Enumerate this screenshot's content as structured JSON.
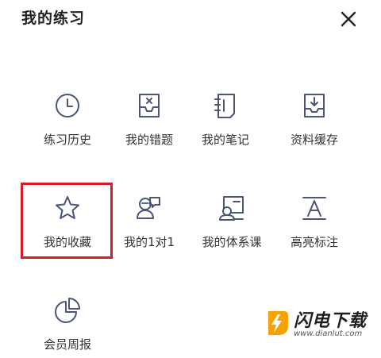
{
  "header": {
    "title": "我的练习",
    "close_icon": "close-icon"
  },
  "grid": {
    "items": [
      {
        "label": "练习历史",
        "icon": "clock-icon"
      },
      {
        "label": "我的错题",
        "icon": "inbox-x-icon"
      },
      {
        "label": "我的笔记",
        "icon": "notebook-icon"
      },
      {
        "label": "资料缓存",
        "icon": "download-tray-icon"
      },
      {
        "label": "我的收藏",
        "icon": "star-icon"
      },
      {
        "label": "我的1对1",
        "icon": "tutor-chat-icon"
      },
      {
        "label": "我的体系课",
        "icon": "course-screen-icon"
      },
      {
        "label": "高亮标注",
        "icon": "highlight-text-icon"
      },
      {
        "label": "会员周报",
        "icon": "pie-chart-icon"
      }
    ]
  },
  "watermark": {
    "title": "闪电下载",
    "url": "www.dianlut.com"
  },
  "colors": {
    "icon_stroke": "#4a5578",
    "highlight_border": "#d21f26",
    "watermark_logo": "#f5a300"
  }
}
